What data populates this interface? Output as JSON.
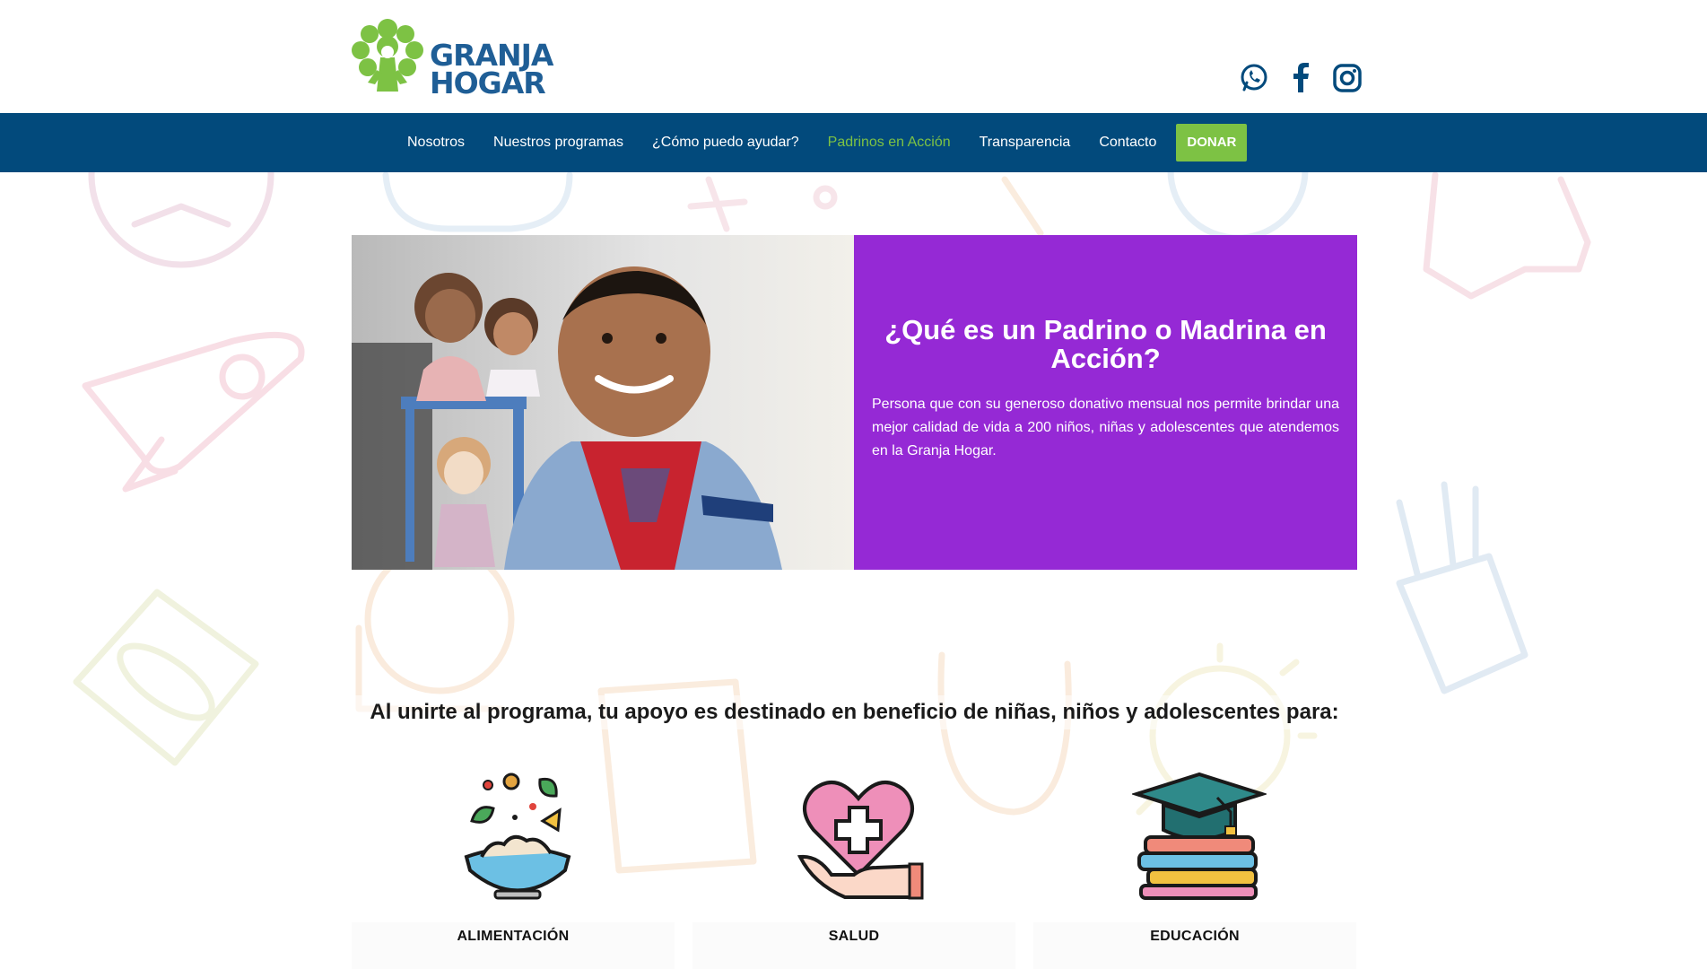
{
  "header": {
    "logo_text_line1": "GRANJA",
    "logo_text_line2": "HOGAR",
    "logo_icon": "tree-logo-icon",
    "social_icons": [
      "whatsapp-icon",
      "facebook-icon",
      "instagram-icon"
    ]
  },
  "nav": {
    "items": [
      {
        "label": "Nosotros"
      },
      {
        "label": "Nuestros programas"
      },
      {
        "label": "¿Cómo puedo ayudar?"
      },
      {
        "label": "Padrinos en Acción",
        "active": true
      },
      {
        "label": "Transparencia"
      },
      {
        "label": "Contacto"
      }
    ],
    "donate_label": "DONAR"
  },
  "hero": {
    "title": "¿Qué es un Padrino o Madrina en Acción?",
    "text": "Persona que con su generoso donativo mensual nos permite brindar una mejor calidad de vida a 200 niños, niñas y adolescentes que atendemos en la Granja Hogar."
  },
  "benefits": {
    "heading": "Al unirte al programa, tu apoyo es destinado en beneficio de niñas, niños y adolescentes para:",
    "items": [
      {
        "label": "ALIMENTACIÓN",
        "icon": "food-bowl-icon"
      },
      {
        "label": "SALUD",
        "icon": "health-heart-icon"
      },
      {
        "label": "EDUCACIÓN",
        "icon": "graduation-books-icon"
      }
    ]
  },
  "colors": {
    "nav_bg": "#024a7c",
    "accent_green": "#7dc244",
    "hero_purple": "#9529d5",
    "logo_blue": "#1f5e96"
  }
}
